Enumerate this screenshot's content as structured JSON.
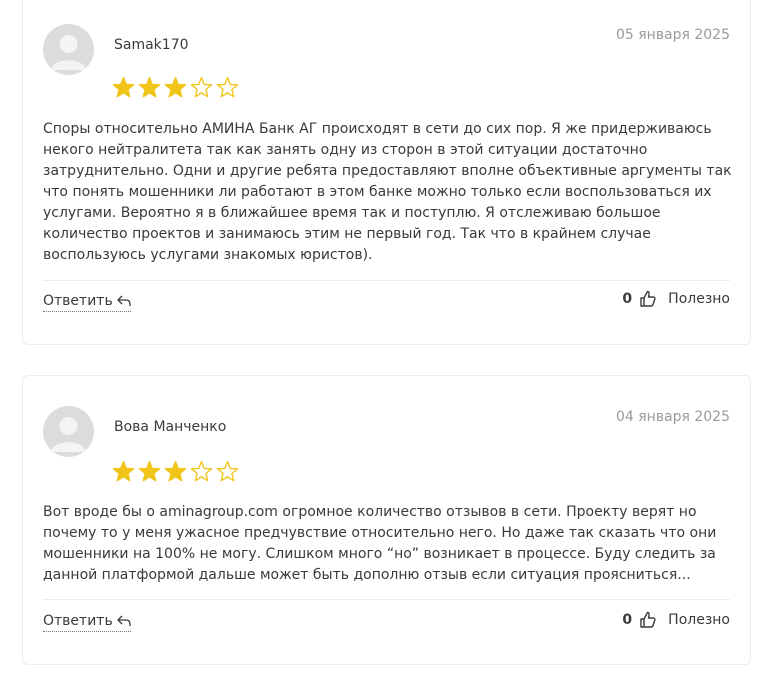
{
  "reviews": [
    {
      "author": "Samak170",
      "date": "05 января 2025",
      "rating": 3,
      "max_rating": 5,
      "text": "Споры относительно АМИНА Банк АГ происходят в сети до сих пор. Я же придерживаюсь некого нейтралитета так как занять одну из сторон в этой ситуации достаточно затруднительно. Одни и другие ребята предоставляют вполне объективные аргументы так что понять мошенники ли работают в этом банке можно только если воспользоваться их услугами. Вероятно я в ближайшее время так и поступлю. Я отслеживаю большое количество проектов и занимаюсь этим не первый год. Так что в крайнем случае воспользуюсь услугами знакомых юристов).",
      "reply_label": "Ответить",
      "likes": "0",
      "useful_label": "Полезно"
    },
    {
      "author": "Вова Манченко",
      "date": "04 января 2025",
      "rating": 3,
      "max_rating": 5,
      "text": "Вот вроде бы о aminagroup.com огромное количество отзывов в сети. Проекту верят но почему то у меня ужасное предчувствие относительно него. Но даже так сказать что они мошенники на 100% не могу. Слишком много “но” возникает в процессе. Буду следить за данной платформой дальше может быть дополню отзыв если ситуация проясниться...",
      "reply_label": "Ответить",
      "likes": "0",
      "useful_label": "Полезно"
    }
  ],
  "colors": {
    "star": "#f0c419",
    "divider": "#ececec",
    "date": "#9a9a9a"
  },
  "icons": {
    "avatar": "user-silhouette",
    "reply": "reply-arrow",
    "like": "thumbs-up"
  }
}
